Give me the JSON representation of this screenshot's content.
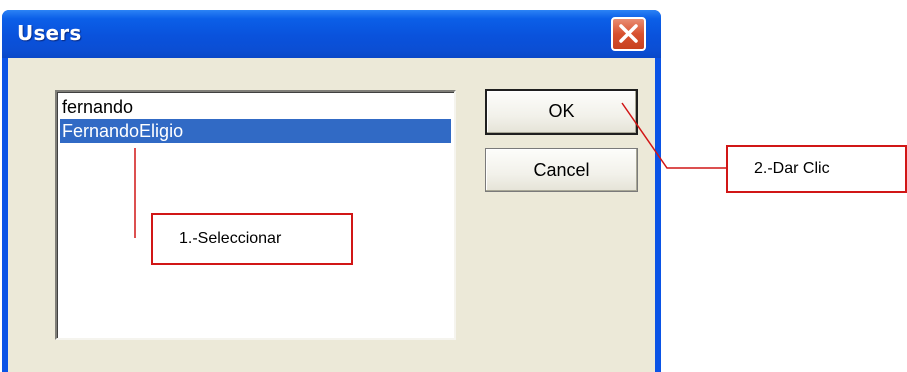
{
  "window": {
    "title": "Users",
    "close_icon": "close-icon"
  },
  "listbox": {
    "items": [
      {
        "label": "fernando",
        "selected": false
      },
      {
        "label": "FernandoEligio",
        "selected": true
      }
    ]
  },
  "buttons": {
    "ok_label": "OK",
    "cancel_label": "Cancel"
  },
  "annotations": {
    "step1": "1.-Seleccionar",
    "step2": "2.-Dar Clic",
    "color": "#d11616"
  },
  "colors": {
    "titlebar": "#0a52dc",
    "dialog_face": "#ece9d8",
    "selection": "#316ac5",
    "close_button": "#d8512f"
  }
}
